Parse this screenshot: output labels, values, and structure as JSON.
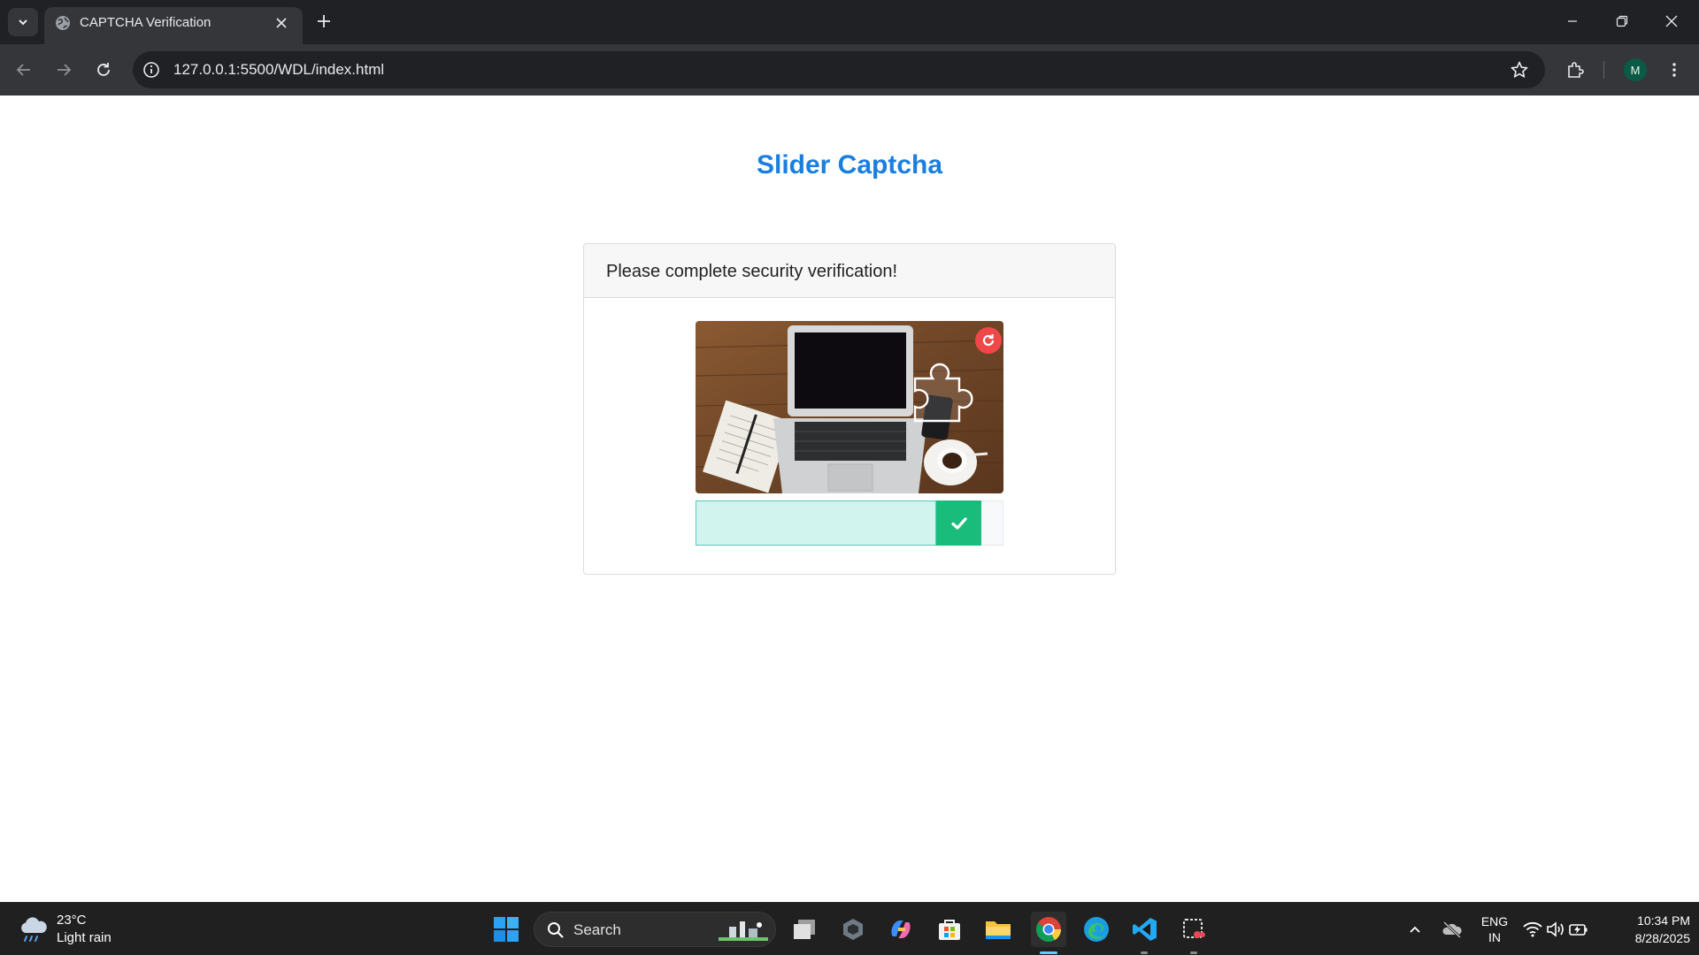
{
  "browser": {
    "tab_title": "CAPTCHA Verification",
    "url": "127.0.0.1:5500/WDL/index.html",
    "profile_initial": "M"
  },
  "page": {
    "title": "Slider Captcha",
    "card_header": "Please complete security verification!",
    "captcha_image": "laptop-on-wooden-desk-with-puzzle-piece-outline",
    "slider_state": "verified",
    "slider_progress": 0.92,
    "colors": {
      "title": "#1a7ee0",
      "refresh_button": "#f04848",
      "slider_fill": "#d2f4ef",
      "slider_handle": "#1abc7b"
    }
  },
  "taskbar": {
    "weather_temp": "23°C",
    "weather_desc": "Light rain",
    "search_label": "Search",
    "lang_line1": "ENG",
    "lang_line2": "IN",
    "time": "10:34 PM",
    "date": "8/28/2025",
    "apps": [
      "start-icon",
      "search",
      "widgets-icon",
      "task-view-icon",
      "copilot-icon",
      "store-icon",
      "file-explorer-icon",
      "chrome-icon",
      "edge-icon",
      "vscode-icon",
      "snipping-tool-icon"
    ]
  }
}
